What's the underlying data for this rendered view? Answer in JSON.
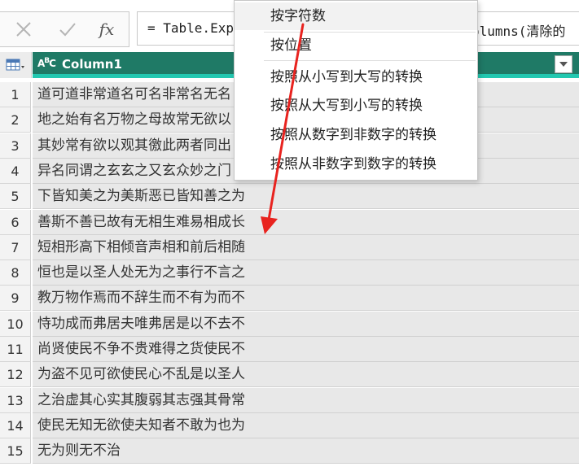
{
  "formula_bar": {
    "cancel_icon": "x-icon",
    "confirm_icon": "check-icon",
    "fx_label": "fx",
    "formula_left": "= Table.Exp",
    "formula_right": "olumns(清除的"
  },
  "table": {
    "column_header": "Column1",
    "type_label_main": "A",
    "type_label_sup": "B",
    "type_label_tail": "C",
    "rows": [
      {
        "num": "1",
        "value": "道可道非常道名可名非常名无名"
      },
      {
        "num": "2",
        "value": "地之始有名万物之母故常无欲以"
      },
      {
        "num": "3",
        "value": "其妙常有欲以观其徼此两者同出"
      },
      {
        "num": "4",
        "value": "异名同谓之玄玄之又玄众妙之门"
      },
      {
        "num": "5",
        "value": "下皆知美之为美斯恶已皆知善之为"
      },
      {
        "num": "6",
        "value": "善斯不善已故有无相生难易相成长"
      },
      {
        "num": "7",
        "value": "短相形高下相倾音声相和前后相随"
      },
      {
        "num": "8",
        "value": "恒也是以圣人处无为之事行不言之"
      },
      {
        "num": "9",
        "value": "教万物作焉而不辞生而不有为而不"
      },
      {
        "num": "10",
        "value": "恃功成而弗居夫唯弗居是以不去不"
      },
      {
        "num": "11",
        "value": "尚贤使民不争不贵难得之货使民不"
      },
      {
        "num": "12",
        "value": "为盗不见可欲使民心不乱是以圣人"
      },
      {
        "num": "13",
        "value": "之治虚其心实其腹弱其志强其骨常"
      },
      {
        "num": "14",
        "value": "使民无知无欲使夫知者不敢为也为"
      },
      {
        "num": "15",
        "value": "无为则无不治"
      }
    ]
  },
  "menu": {
    "items": [
      {
        "label": "按字符数"
      },
      {
        "label": "按位置"
      },
      {
        "label": "按照从小写到大写的转换"
      },
      {
        "label": "按照从大写到小写的转换"
      },
      {
        "label": "按照从数字到非数字的转换"
      },
      {
        "label": "按照从非数字到数字的转换"
      }
    ]
  },
  "colors": {
    "header_bg": "#1f7a66",
    "header_accent": "#22c8b0",
    "annotation_arrow": "#e8231f"
  }
}
